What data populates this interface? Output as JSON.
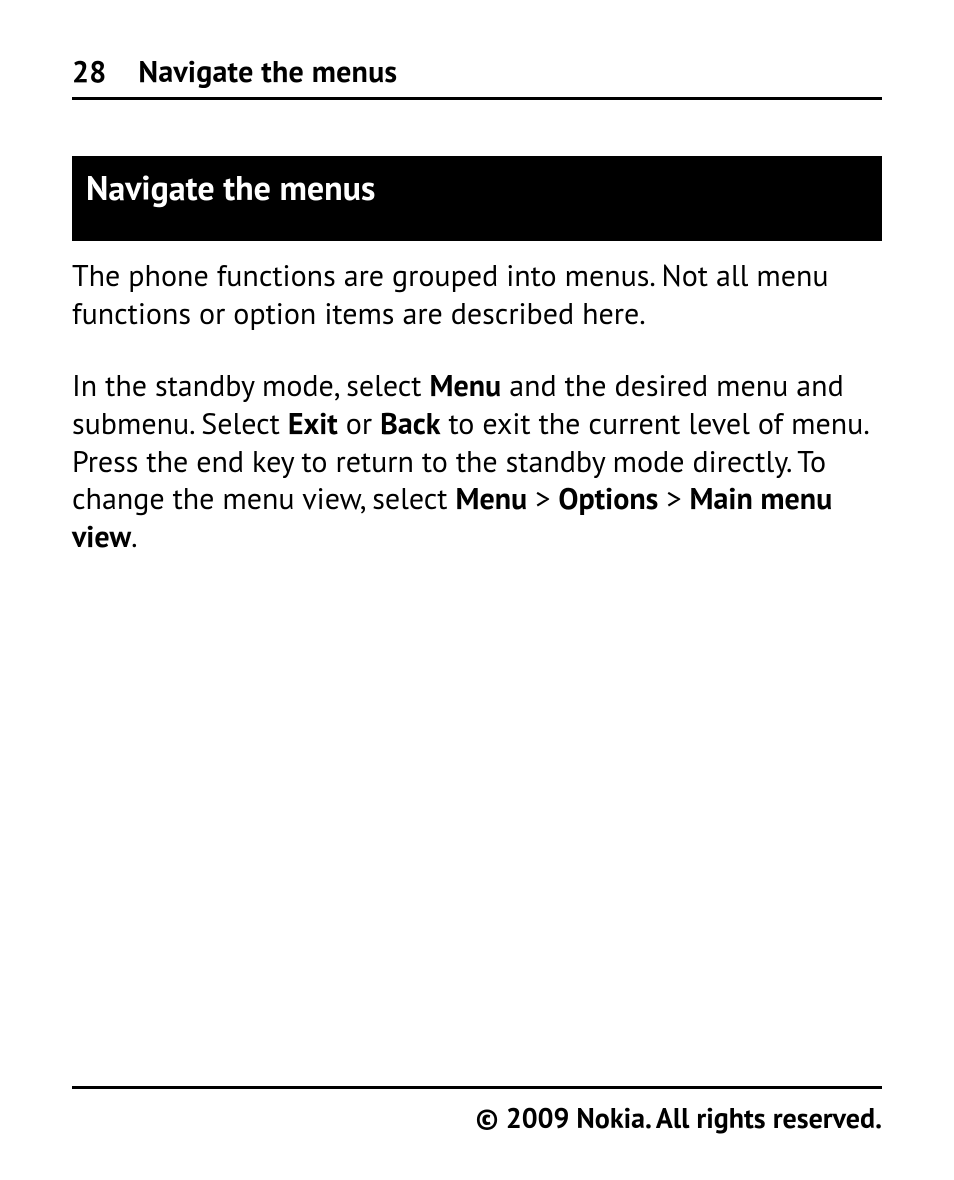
{
  "header": {
    "page_number": "28",
    "title": "Navigate the menus"
  },
  "section": {
    "title": "Navigate the menus"
  },
  "paragraphs": {
    "p1": "The phone functions are grouped into menus. Not all menu functions or option items are described here.",
    "p2_a": "In the standby mode, select ",
    "p2_b_menu": "Menu",
    "p2_c": " and the desired menu and submenu. Select ",
    "p2_d_exit": "Exit",
    "p2_e": " or ",
    "p2_f_back": "Back",
    "p2_g": " to exit the current level of menu. Press the end key to return to the standby mode directly. To change the menu view, select ",
    "p2_h_menu2": "Menu",
    "p2_i": " > ",
    "p2_j_options": "Options",
    "p2_k": " > ",
    "p2_l_mainmenu": "Main menu view",
    "p2_m": "."
  },
  "footer": {
    "copyright": "© 2009 Nokia. All rights reserved."
  }
}
